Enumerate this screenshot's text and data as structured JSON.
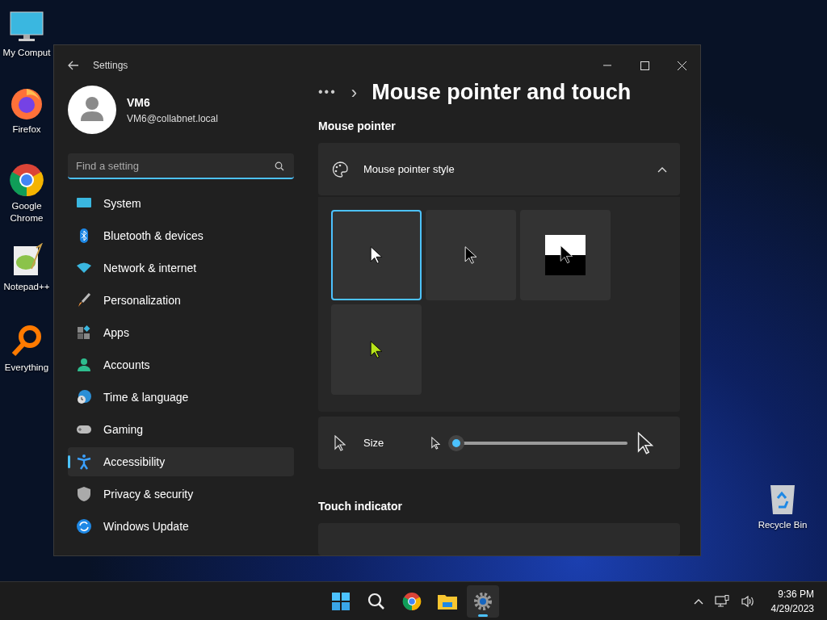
{
  "desktop_icons": [
    {
      "kind": "computer",
      "label": "My Comput"
    },
    {
      "kind": "firefox",
      "label": "Firefox"
    },
    {
      "kind": "chrome",
      "label": "Google Chrome"
    },
    {
      "kind": "notepad",
      "label": "Notepad++"
    },
    {
      "kind": "everything",
      "label": "Everything"
    },
    {
      "kind": "recycle",
      "label": "Recycle Bin"
    }
  ],
  "window": {
    "title": "Settings"
  },
  "account": {
    "name": "VM6",
    "email": "VM6@collabnet.local"
  },
  "search": {
    "placeholder": "Find a setting"
  },
  "sidebar": {
    "items": [
      {
        "kind": "system",
        "label": "System",
        "selected": false
      },
      {
        "kind": "bluetooth",
        "label": "Bluetooth & devices",
        "selected": false
      },
      {
        "kind": "network",
        "label": "Network & internet",
        "selected": false
      },
      {
        "kind": "personalization",
        "label": "Personalization",
        "selected": false
      },
      {
        "kind": "apps",
        "label": "Apps",
        "selected": false
      },
      {
        "kind": "accounts",
        "label": "Accounts",
        "selected": false
      },
      {
        "kind": "time",
        "label": "Time & language",
        "selected": false
      },
      {
        "kind": "gaming",
        "label": "Gaming",
        "selected": false
      },
      {
        "kind": "accessibility",
        "label": "Accessibility",
        "selected": true
      },
      {
        "kind": "privacy",
        "label": "Privacy & security",
        "selected": false
      },
      {
        "kind": "update",
        "label": "Windows Update",
        "selected": false
      }
    ]
  },
  "breadcrumb": {
    "overflow": "•••",
    "separator": "›",
    "title": "Mouse pointer and touch"
  },
  "mouse_pointer": {
    "heading": "Mouse pointer",
    "style_card": {
      "label": "Mouse pointer style",
      "expanded": true
    },
    "styles": [
      {
        "kind": "white",
        "selected": true
      },
      {
        "kind": "black",
        "selected": false
      },
      {
        "kind": "inverted",
        "selected": false
      },
      {
        "kind": "custom",
        "selected": false,
        "color": "#b8e41a"
      }
    ],
    "size": {
      "label": "Size",
      "level": 0.0
    }
  },
  "touch_indicator": {
    "heading": "Touch indicator"
  },
  "taskbar": {
    "apps": [
      {
        "kind": "start",
        "selected": false
      },
      {
        "kind": "search",
        "selected": false
      },
      {
        "kind": "chrome",
        "selected": false
      },
      {
        "kind": "explorer",
        "selected": false
      },
      {
        "kind": "settings",
        "selected": true
      }
    ],
    "time": "9:36 PM",
    "date": "4/29/2023"
  }
}
